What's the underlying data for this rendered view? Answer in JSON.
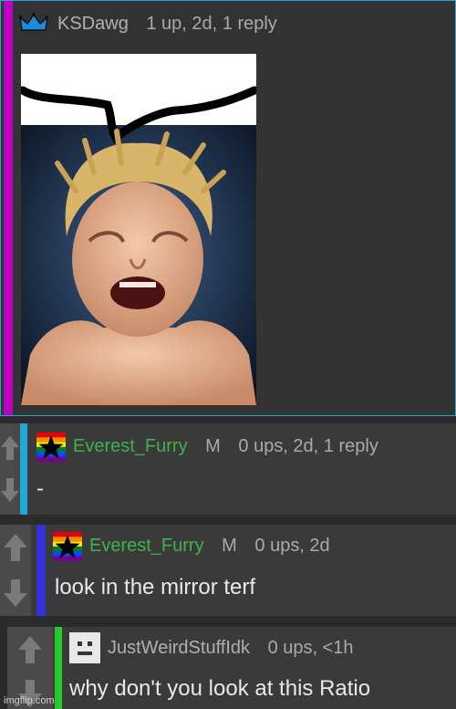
{
  "comments": [
    {
      "username": "KSDawg",
      "meta": "1 up, 2d, 1 reply",
      "bar_color": "#c000c0",
      "image_alt": "crying child meme with drawn mustache"
    },
    {
      "username": "Everest_Furry",
      "badge": "M",
      "meta": "0 ups, 2d, 1 reply",
      "text": "-",
      "bar_color": "#1fa8d6"
    },
    {
      "username": "Everest_Furry",
      "badge": "M",
      "meta": "0 ups, 2d",
      "text": "look in the mirror terf",
      "bar_color": "#3232d8"
    },
    {
      "username": "JustWeirdStuffIdk",
      "meta": "0 ups, <1h",
      "text": "why don't you look at this Ratio",
      "bar_color": "#28c828"
    }
  ],
  "watermark": "imgflip.com",
  "icons": {
    "crown": "crown-icon",
    "flag": "rainbow-star-flag-icon",
    "default_avatar": "default-avatar-icon",
    "upvote": "upvote-arrow-icon",
    "downvote": "downvote-arrow-icon"
  }
}
